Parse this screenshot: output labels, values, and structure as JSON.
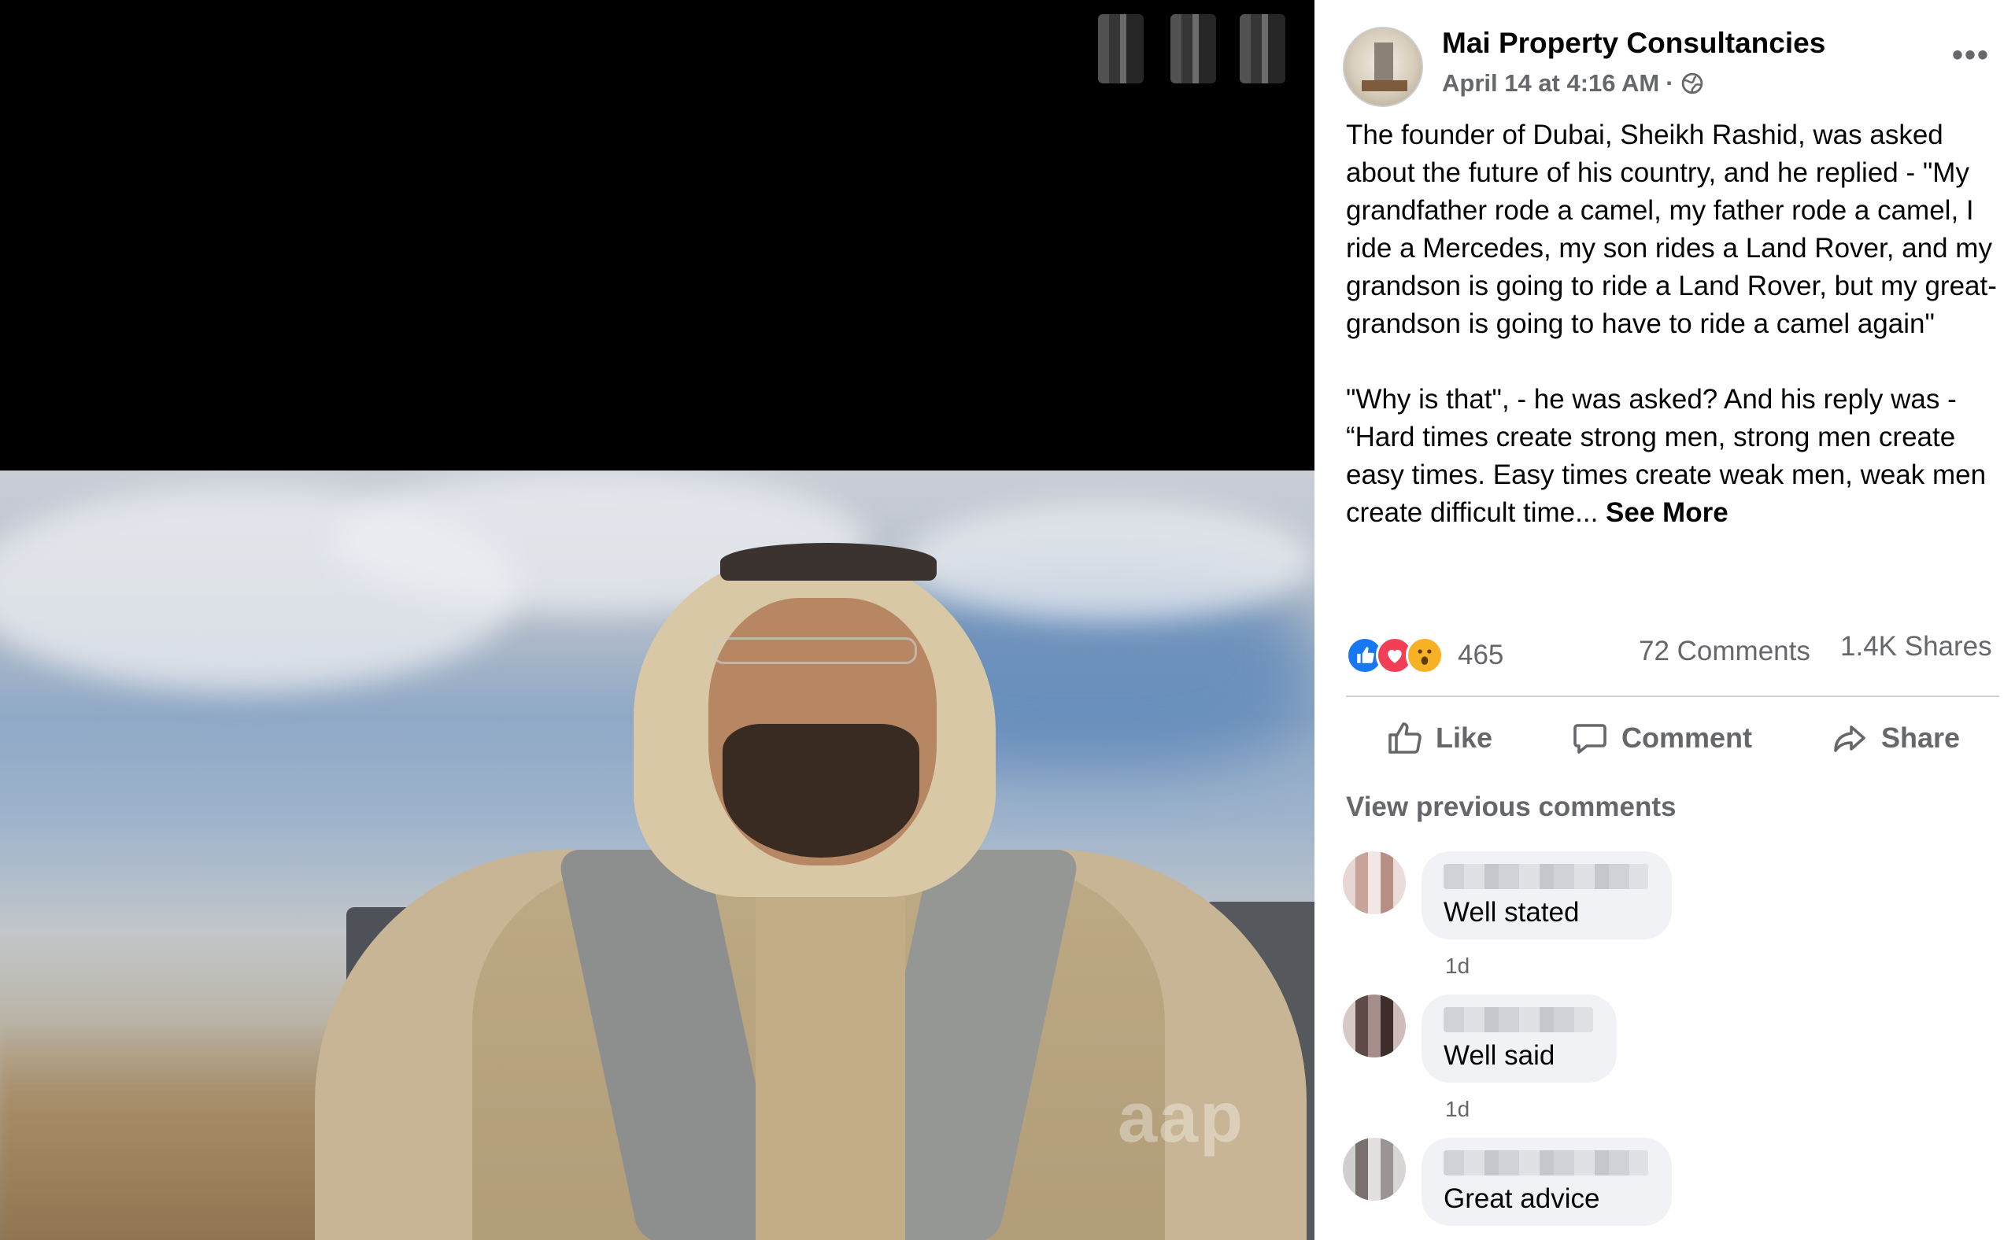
{
  "post": {
    "page_name": "Mai Property Consultancies",
    "timestamp": "April 14 at 4:16 AM",
    "separator": "·",
    "body_text": "The founder of Dubai, Sheikh Rashid, was asked about the future of his country, and he replied - \"My grandfather rode a camel, my father rode a camel, I ride a Mercedes, my son rides a Land Rover, and my grandson is going to ride a Land Rover, but my great-grandson is going to have to ride a camel again\"\n\n\"Why is that\", - he was asked? And his reply was - “Hard times create strong men, strong men create easy times. Easy times create weak men, weak men create difficult time... ",
    "see_more_label": "See More"
  },
  "stats": {
    "reaction_count": "465",
    "comments": "72 Comments",
    "shares": "1.4K Shares",
    "reaction_icons": [
      "like-icon",
      "love-icon",
      "wow-icon"
    ]
  },
  "actions": {
    "like_label": "Like",
    "comment_label": "Comment",
    "share_label": "Share"
  },
  "comments_section": {
    "view_previous_label": "View previous comments",
    "comments": [
      {
        "text": "Well stated",
        "time": "1d"
      },
      {
        "text": "Well said",
        "time": "1d"
      },
      {
        "text": "Great advice"
      }
    ]
  },
  "media": {
    "watermark": "aap"
  },
  "colors": {
    "secondary_text": "#65676b",
    "bubble_bg": "#f0f2f5",
    "like_blue": "#1877f2",
    "love_red": "#f33e58",
    "wow_yellow": "#f7b125"
  }
}
